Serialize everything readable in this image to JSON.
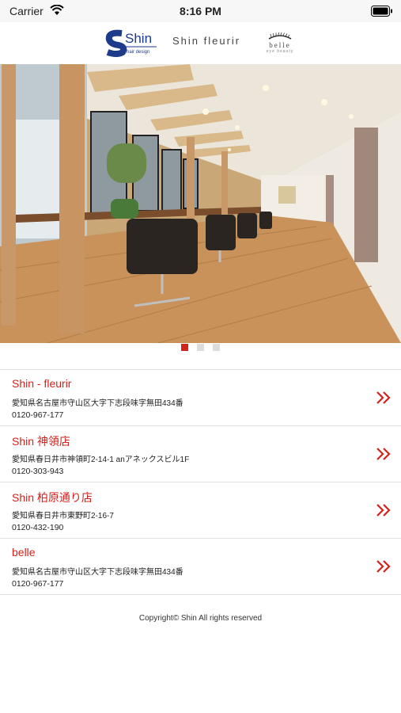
{
  "status": {
    "carrier": "Carrier",
    "time": "8:16 PM"
  },
  "header": {
    "logo_shin": "Shin",
    "logo_shin_sub": "hair design",
    "logo_fleurir": "Shin  fleurir",
    "logo_belle": "belle",
    "logo_belle_sub": "eye beauty"
  },
  "carousel": {
    "active_index": 0,
    "count": 3,
    "active_color": "#d2231d",
    "inactive_color": "#dcdcdc"
  },
  "salons": [
    {
      "name": "Shin - fleurir",
      "address": "愛知県名古屋市守山区大字下志段味字無田434番",
      "phone": "0120-967-177"
    },
    {
      "name": "Shin 神領店",
      "address": "愛知県春日井市神領町2-14-1 anアネックスビル1F",
      "phone": "0120-303-943"
    },
    {
      "name": "Shin 柏原通り店",
      "address": "愛知県春日井市東野町2-16-7",
      "phone": "0120-432-190"
    },
    {
      "name": "belle",
      "address": "愛知県名古屋市守山区大字下志段味字無田434番",
      "phone": "0120-967-177"
    }
  ],
  "footer": {
    "copyright": "Copyright© Shin All rights reserved"
  },
  "colors": {
    "accent": "#d2231d",
    "brand_navy": "#1e3a8a"
  }
}
